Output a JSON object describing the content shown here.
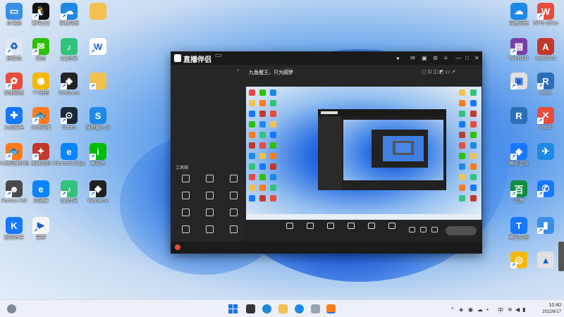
{
  "desktop": {
    "left_icons": [
      {
        "label": "此电脑",
        "color": "#3a8ee6",
        "glyph": "▭"
      },
      {
        "label": "腾讯QQ",
        "color": "#111111",
        "glyph": "🐧"
      },
      {
        "label": "百度网盘",
        "color": "#1e88e5",
        "glyph": "☁"
      },
      {
        "label": "",
        "color": "#f2c14e",
        "glyph": ""
      },
      {
        "label": "回收站",
        "color": "#e0e6ef",
        "glyph": "♻"
      },
      {
        "label": "微信",
        "color": "#2dc100",
        "glyph": "✉"
      },
      {
        "label": "QQ音乐",
        "color": "#31c27c",
        "glyph": "♪"
      },
      {
        "label": "",
        "color": "#ffffff",
        "glyph": "W"
      },
      {
        "label": "控制面板",
        "color": "#e74c3c",
        "glyph": "✿"
      },
      {
        "label": "YY语音",
        "color": "#f5b800",
        "glyph": "◉"
      },
      {
        "label": "WeGame",
        "color": "#222222",
        "glyph": "◆"
      },
      {
        "label": "",
        "color": "#f2c14e",
        "glyph": ""
      },
      {
        "label": "火绒安全",
        "color": "#1677ff",
        "glyph": "✚"
      },
      {
        "label": "斗鱼直播",
        "color": "#ff7b1a",
        "glyph": "🐟"
      },
      {
        "label": "Steam",
        "color": "#1b2838",
        "glyph": "⊙"
      },
      {
        "label": "搜狗输入法",
        "color": "#1e88e5",
        "glyph": "S"
      },
      {
        "label": "斗鱼直播伴侣",
        "color": "#ff7b1a",
        "glyph": "🐟"
      },
      {
        "label": "英雄联盟",
        "color": "#c0392b",
        "glyph": "✦"
      },
      {
        "label": "Microsoft Edge",
        "color": "#0a84ff",
        "glyph": "e"
      },
      {
        "label": "爱奇艺",
        "color": "#00be06",
        "glyph": "i"
      },
      {
        "label": "Human Fall",
        "color": "#4a4a4a",
        "glyph": "☻"
      },
      {
        "label": "浏览器",
        "color": "#0a84ff",
        "glyph": "e"
      },
      {
        "label": "QQ音乐",
        "color": "#31c27c",
        "glyph": "♪"
      },
      {
        "label": "WeGame",
        "color": "#222222",
        "glyph": "◆"
      },
      {
        "label": "酷狗音乐",
        "color": "#1677ff",
        "glyph": "K"
      },
      {
        "label": "录屏",
        "color": "#f5f5f5",
        "glyph": "▶"
      }
    ],
    "right_icons": [
      {
        "label": "百度网盘",
        "color": "#1e88e5",
        "glyph": "☁"
      },
      {
        "label": "WPS Office",
        "color": "#e74c3c",
        "glyph": "W"
      },
      {
        "label": "WinRAR",
        "color": "#7a3ea8",
        "glyph": "▤"
      },
      {
        "label": "AutoCAD",
        "color": "#c0392b",
        "glyph": "A"
      },
      {
        "label": "",
        "color": "#e0e0e0",
        "glyph": "▣"
      },
      {
        "label": "Revit",
        "color": "#2c6fb7",
        "glyph": "R"
      },
      {
        "label": "",
        "color": "#2c6fb7",
        "glyph": "R"
      },
      {
        "label": "XMind",
        "color": "#e74c3c",
        "glyph": "✕"
      },
      {
        "label": "腾讯会议",
        "color": "#1677ff",
        "glyph": "◆"
      },
      {
        "label": "",
        "color": "#1e88e5",
        "glyph": "✈"
      },
      {
        "label": "百度",
        "color": "#0f8f3f",
        "glyph": "百"
      },
      {
        "label": "",
        "color": "#1677ff",
        "glyph": "✆"
      },
      {
        "label": "腾讯文档",
        "color": "#1677ff",
        "glyph": "T"
      },
      {
        "label": "",
        "color": "#3a8ee6",
        "glyph": "▮"
      },
      {
        "label": "",
        "color": "#f5b800",
        "glyph": "◎"
      },
      {
        "label": "",
        "color": "#e0e0e0",
        "glyph": "▲"
      }
    ]
  },
  "window": {
    "app_name": "直播伴侣",
    "version": "",
    "sidebar_tabs": [
      "",
      "",
      ""
    ],
    "scenes": [
      "",
      "",
      "",
      ""
    ],
    "tool_title": "工具箱",
    "tools": [
      "",
      "",
      "",
      "",
      "",
      "",
      "",
      "",
      "",
      "",
      "",
      ""
    ],
    "main_title": "九鱼醒王，只为圆梦",
    "main_tag": "",
    "controls": [
      "",
      "",
      "",
      "",
      "",
      ""
    ],
    "start_live": "",
    "status_text": "",
    "status_stats": ""
  },
  "taskbar": {
    "time": "10:40",
    "date": "2022/6/17"
  }
}
